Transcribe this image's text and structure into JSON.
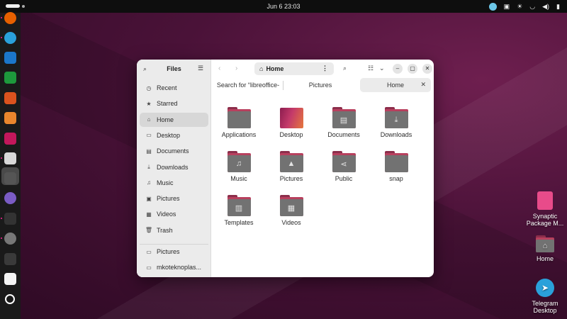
{
  "topbar": {
    "datetime": "Jun 6  23:03",
    "tray_icons": [
      "telegram-icon",
      "clipboard-icon",
      "brightness-icon",
      "wifi-icon",
      "volume-icon",
      "battery-icon"
    ]
  },
  "dock": {
    "apps": [
      {
        "name": "firefox-icon",
        "color": "#e66000"
      },
      {
        "name": "telegram-icon",
        "color": "#2aa1da"
      },
      {
        "name": "libreoffice-writer-icon",
        "color": "#1b77c8"
      },
      {
        "name": "libreoffice-calc-icon",
        "color": "#1d9a3c"
      },
      {
        "name": "libreoffice-impress-icon",
        "color": "#d9531e"
      },
      {
        "name": "app-store-icon",
        "color": "#e9862d"
      },
      {
        "name": "vscode-icon",
        "color": "#c2185b"
      },
      {
        "name": "files-icon",
        "color": "#d8d8d8"
      },
      {
        "name": "system-tool-icon",
        "color": "#555555"
      },
      {
        "name": "settings-dots-icon",
        "color": "#7a5cc4"
      },
      {
        "name": "terminal-icon",
        "color": "#333333"
      },
      {
        "name": "clock-icon",
        "color": "#777777"
      },
      {
        "name": "system-monitor-icon",
        "color": "#3a3a3a"
      },
      {
        "name": "monitor-graph-icon",
        "color": "#f5f5f5"
      },
      {
        "name": "ubuntu-icon",
        "color": "#ffffff"
      }
    ]
  },
  "desktop": {
    "icons": [
      {
        "label": "Synaptic\nPackage M...",
        "icon": "synaptic-icon"
      },
      {
        "label": "Home",
        "icon": "home-folder-icon"
      },
      {
        "label": "Telegram\nDesktop",
        "icon": "telegram-icon"
      }
    ]
  },
  "files": {
    "title": "Files",
    "sidebar": [
      {
        "label": "Recent",
        "icon": "clock-icon"
      },
      {
        "label": "Starred",
        "icon": "star-icon"
      },
      {
        "label": "Home",
        "icon": "home-icon",
        "selected": true
      },
      {
        "label": "Desktop",
        "icon": "desktop-icon"
      },
      {
        "label": "Documents",
        "icon": "document-icon"
      },
      {
        "label": "Downloads",
        "icon": "download-icon"
      },
      {
        "label": "Music",
        "icon": "music-icon"
      },
      {
        "label": "Pictures",
        "icon": "picture-icon"
      },
      {
        "label": "Videos",
        "icon": "video-icon"
      },
      {
        "label": "Trash",
        "icon": "trash-icon"
      }
    ],
    "bookmarks": [
      {
        "label": "Pictures",
        "icon": "folder-icon"
      },
      {
        "label": "mkoteknoplas...",
        "icon": "folder-icon"
      }
    ],
    "path": "Home",
    "tabs": [
      {
        "label": "Search for “libreoffice-",
        "active": false
      },
      {
        "label": "Pictures",
        "active": false
      },
      {
        "label": "Home",
        "active": true
      }
    ],
    "folders": [
      {
        "label": "Applications",
        "glyph": ""
      },
      {
        "label": "Desktop",
        "glyph": "",
        "desktop": true
      },
      {
        "label": "Documents",
        "glyph": "▤"
      },
      {
        "label": "Downloads",
        "glyph": "⤓"
      },
      {
        "label": "Music",
        "glyph": "♫"
      },
      {
        "label": "Pictures",
        "glyph": "▲"
      },
      {
        "label": "Public",
        "glyph": "⋖"
      },
      {
        "label": "snap",
        "glyph": ""
      },
      {
        "label": "Templates",
        "glyph": "▥"
      },
      {
        "label": "Videos",
        "glyph": "▦"
      }
    ]
  }
}
